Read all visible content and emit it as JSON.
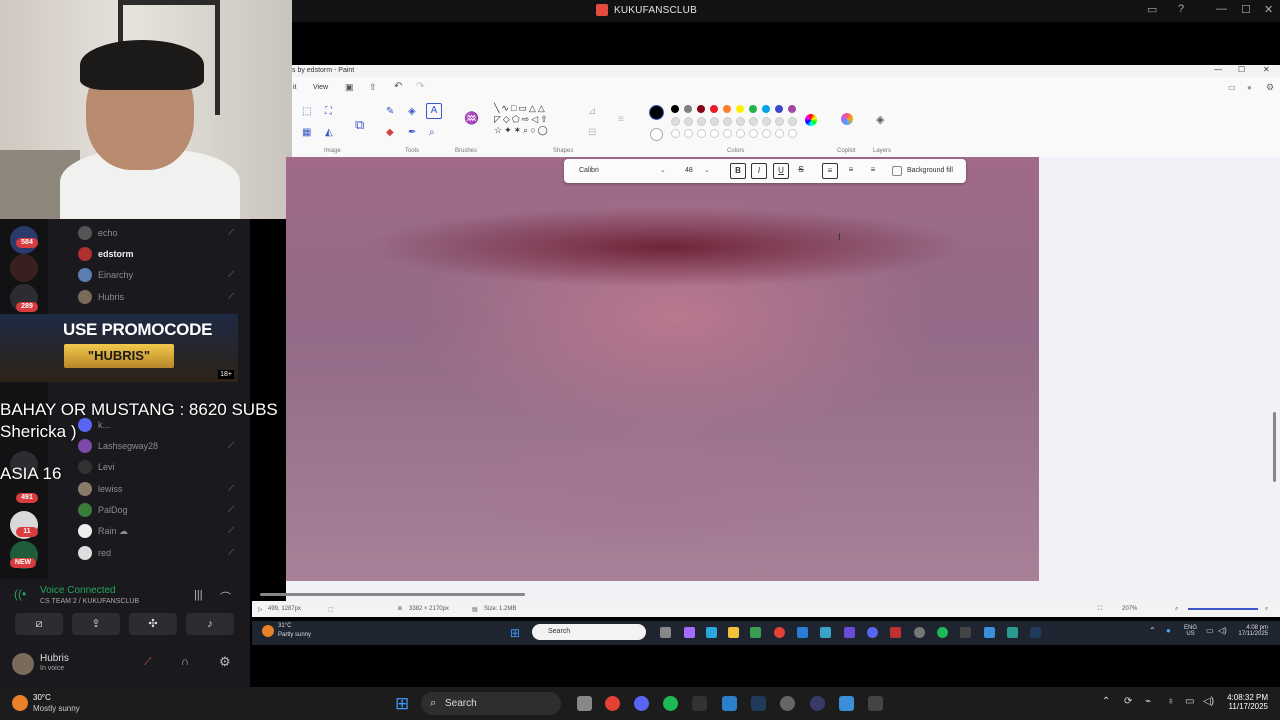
{
  "window": {
    "title": "KUKUFANSCLUB"
  },
  "discord": {
    "members": [
      {
        "name": "echo"
      },
      {
        "name": "edstorm"
      },
      {
        "name": "Einarchy"
      },
      {
        "name": "Hubris"
      },
      {
        "name": "Lashsegway28"
      },
      {
        "name": "Levi"
      },
      {
        "name": "lewiss"
      },
      {
        "name": "PalDog"
      },
      {
        "name": "Rain ☁"
      },
      {
        "name": "red"
      },
      {
        "name": "k..."
      }
    ],
    "badges": [
      "584",
      "289",
      "491",
      "11",
      "NEW"
    ],
    "voice": {
      "status": "Voice Connected",
      "channel": "CS TEAM 2 / KUKUFANSCLUB"
    },
    "user": {
      "name": "Hubris",
      "status": "In voice"
    }
  },
  "promo": {
    "line1": "USE PROMOCODE",
    "line2": "\"HUBRIS\"",
    "age": "18+"
  },
  "overlay": {
    "line1": "BAHAY OR MUSTANG : 8620 SUBS",
    "line2": "Shericka )",
    "line3": "ASIA 16"
  },
  "paint": {
    "title": "s by edstorm - Paint",
    "menu": {
      "edit": "it",
      "view": "View"
    },
    "groups": [
      "Image",
      "Tools",
      "Brushes",
      "Shapes",
      "Colors",
      "Copilot",
      "Layers"
    ],
    "textbar": {
      "font": "Calibri",
      "size": "48",
      "bold": "B",
      "italic": "I",
      "underline": "U",
      "strike": "S",
      "bgfill": "Background fill"
    },
    "status": {
      "cursor": "499, 1287px",
      "dims": "3382 × 2170px",
      "size": "Size: 1.2MB",
      "zoom": "207%"
    },
    "colors": [
      "#000000",
      "#7f7f7f",
      "#880015",
      "#ed1c24",
      "#ff7f27",
      "#fff200",
      "#22b14c",
      "#00a2e8",
      "#3f48cc",
      "#a349a4"
    ]
  },
  "inner_taskbar": {
    "temp": "31°C",
    "weather": "Partly sunny",
    "search": "Search",
    "lang1": "ENG",
    "lang2": "US",
    "time": "4:08 pm",
    "date": "17/11/2025"
  },
  "taskbar": {
    "temp": "30°C",
    "weather": "Mostly sunny",
    "search": "Search",
    "time": "4:08:32 PM",
    "date": "11/17/2025"
  }
}
